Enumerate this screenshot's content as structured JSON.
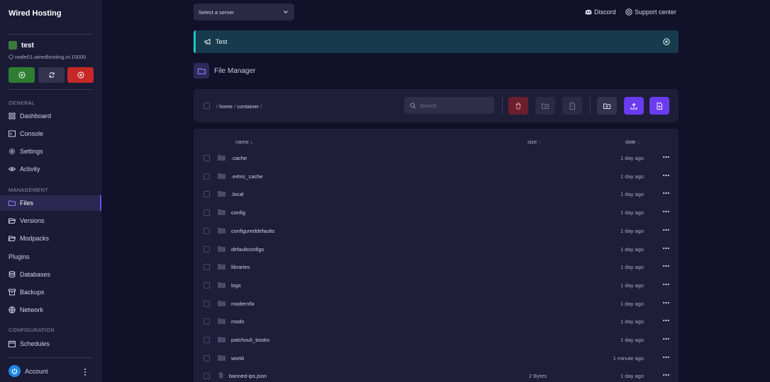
{
  "sidebar": {
    "brand": "Wired Hosting",
    "server": {
      "name": "test",
      "address": "node01.wiredhosting.ni:10000",
      "color": "#3b7a3b"
    },
    "controls": [
      "start-icon",
      "restart-icon",
      "stop-icon"
    ],
    "sections": {
      "general": "GENERAL",
      "management": "MANAGEMENT",
      "configuration": "CONFIGURATION"
    },
    "nav": {
      "dashboard": "Dashboard",
      "console": "Console",
      "settings": "Settings",
      "activity": "Activity",
      "files": "Files",
      "versions": "Versions",
      "modpacks": "Modpacks",
      "plugins": "Plugins",
      "databases": "Databases",
      "backups": "Backups",
      "network": "Network",
      "schedules": "Schedules"
    },
    "account": "Account"
  },
  "header": {
    "server_select": "Select a server",
    "discord": "Discord",
    "support": "Support center"
  },
  "announcement": {
    "text": "Test",
    "accent": "#1ec8c8"
  },
  "page": {
    "title": "File Manager"
  },
  "toolbar": {
    "breadcrumb": {
      "sep": "/",
      "home": "home",
      "container": "container"
    },
    "search_placeholder": "Search"
  },
  "table": {
    "headers": {
      "name": "name",
      "size": "size",
      "date": "date"
    },
    "rows": [
      {
        "name": ".cache",
        "type": "folder",
        "size": "",
        "date": "1 day ago"
      },
      {
        "name": ".e4mc_cache",
        "type": "folder",
        "size": "",
        "date": "1 day ago"
      },
      {
        "name": ".local",
        "type": "folder",
        "size": "",
        "date": "1 day ago"
      },
      {
        "name": "config",
        "type": "folder",
        "size": "",
        "date": "1 day ago"
      },
      {
        "name": "configureddefaults",
        "type": "folder",
        "size": "",
        "date": "1 day ago"
      },
      {
        "name": "defaultconfigs",
        "type": "folder",
        "size": "",
        "date": "1 day ago"
      },
      {
        "name": "libraries",
        "type": "folder",
        "size": "",
        "date": "1 day ago"
      },
      {
        "name": "logs",
        "type": "folder",
        "size": "",
        "date": "1 day ago"
      },
      {
        "name": "modernfix",
        "type": "folder",
        "size": "",
        "date": "1 day ago"
      },
      {
        "name": "mods",
        "type": "folder",
        "size": "",
        "date": "1 day ago"
      },
      {
        "name": "patchouli_books",
        "type": "folder",
        "size": "",
        "date": "1 day ago"
      },
      {
        "name": "world",
        "type": "folder",
        "size": "",
        "date": "1 minute ago"
      },
      {
        "name": "banned-ips.json",
        "type": "file",
        "size": "2 Bytes",
        "date": "1 day ago"
      }
    ]
  }
}
